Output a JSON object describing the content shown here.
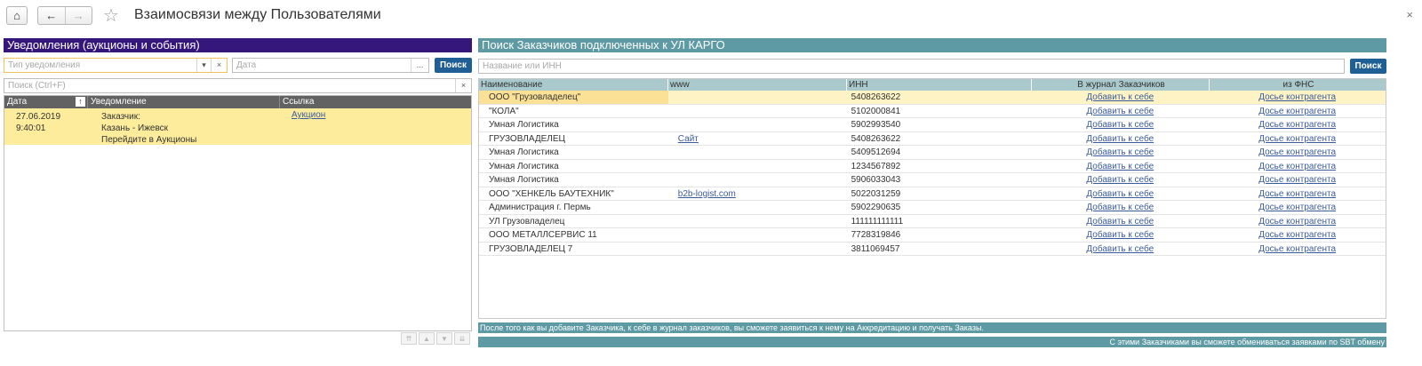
{
  "window": {
    "title": "Взаимосвязи между Пользователями",
    "home_icon": "home-icon",
    "back_icon": "arrow-left-icon",
    "forward_icon": "arrow-right-icon",
    "favorite_icon": "star-icon",
    "close_icon": "close-icon",
    "home_glyph": "⌂",
    "back_glyph": "←",
    "forward_glyph": "→",
    "star_glyph": "☆",
    "close_glyph": "×"
  },
  "left": {
    "header": "Уведомления (аукционы и события)",
    "type_placeholder": "Тип уведомления",
    "date_placeholder": "Дата",
    "dropdown_glyph": "▾",
    "clear_glyph": "×",
    "ellipsis_glyph": "...",
    "search_button": "Поиск",
    "quick_search_placeholder": "Поиск (Ctrl+F)",
    "quick_clear_glyph": "×",
    "columns": {
      "date": "Дата",
      "sort_glyph": "↑",
      "notification": "Уведомление",
      "link": "Ссылка"
    },
    "rows": [
      {
        "date": "27.06.2019",
        "time": "9:40:01",
        "line1": "Заказчик:",
        "line2": "Казань - Ижевск",
        "line3": "Перейдите в Аукционы",
        "link": "Аукцион"
      }
    ],
    "pager": [
      "⇈",
      "▲",
      "▼",
      "⇊"
    ]
  },
  "right": {
    "header": "Поиск Заказчиков подключенных к УЛ КАРГО",
    "search_placeholder": "Название или ИНН",
    "search_button": "Поиск",
    "columns": {
      "name": "Наименование",
      "www": "www",
      "inn": "ИНН",
      "journal": "В журнал Заказчиков",
      "fns": "из ФНС"
    },
    "rows": [
      {
        "name": "ООО \"Грузовладелец\"",
        "www": "",
        "inn": "5408263622",
        "add": "Добавить к себе",
        "fns": "Досье контрагента"
      },
      {
        "name": "\"КОЛА\"",
        "www": "",
        "inn": "5102000841",
        "add": "Добавить к себе",
        "fns": "Досье контрагента"
      },
      {
        "name": "Умная Логистика",
        "www": "",
        "inn": "5902993540",
        "add": "Добавить к себе",
        "fns": "Досье контрагента"
      },
      {
        "name": "ГРУЗОВЛАДЕЛЕЦ",
        "www": "Сайт",
        "inn": "5408263622",
        "add": "Добавить к себе",
        "fns": "Досье контрагента"
      },
      {
        "name": "Умная Логистика",
        "www": "",
        "inn": "5409512694",
        "add": "Добавить к себе",
        "fns": "Досье контрагента"
      },
      {
        "name": "Умная Логистика",
        "www": "",
        "inn": "1234567892",
        "add": "Добавить к себе",
        "fns": "Досье контрагента"
      },
      {
        "name": "Умная Логистика",
        "www": "",
        "inn": "5906033043",
        "add": "Добавить к себе",
        "fns": "Досье контрагента"
      },
      {
        "name": "ООО \"ХЕНКЕЛЬ БАУТЕХНИК\"",
        "www": "b2b-logist.com",
        "inn": "5022031259",
        "add": "Добавить к себе",
        "fns": "Досье контрагента"
      },
      {
        "name": "Администрация г. Пермь",
        "www": "",
        "inn": "5902290635",
        "add": "Добавить к себе",
        "fns": "Досье контрагента"
      },
      {
        "name": "УЛ Грузовладелец",
        "www": "",
        "inn": "111111111111",
        "add": "Добавить к себе",
        "fns": "Досье контрагента"
      },
      {
        "name": "ООО МЕТАЛЛСЕРВИС 11",
        "www": "",
        "inn": "7728319846",
        "add": "Добавить к себе",
        "fns": "Досье контрагента"
      },
      {
        "name": "ГРУЗОВЛАДЕЛЕЦ 7",
        "www": "",
        "inn": "3811069457",
        "add": "Добавить к себе",
        "fns": "Досье контрагента"
      }
    ],
    "notice": "После того как  вы добавите Заказчика, к себе в журнал заказчиков, вы сможете заявиться к нему на Аккредитацию и получать Заказы.",
    "notice2": "С этими Заказчиками вы сможете обмениваться заявками по SBT обмену"
  },
  "colors": {
    "left_header": "#35167a",
    "right_header": "#5d9aa3",
    "search_button": "#1f5f96",
    "selected_row": "#fcec9c"
  }
}
